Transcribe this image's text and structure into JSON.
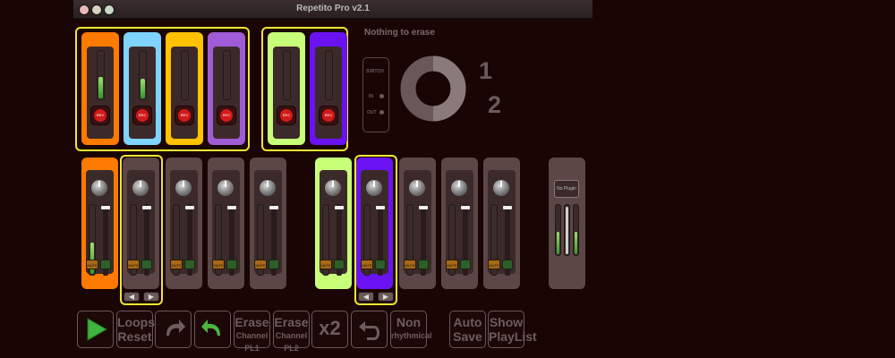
{
  "window": {
    "title": "Repetito Pro v2.1"
  },
  "status_text": "Nothing to erase",
  "loop_modes": [
    "SWITCH",
    "IN",
    "OUT"
  ],
  "loop_counter": {
    "first": "1",
    "second": "2"
  },
  "rec_label": "REC",
  "mute_label": "MUTE",
  "plugin_label": "No Plugin",
  "toolbar": {
    "loops_reset": [
      "Loops",
      "Reset"
    ],
    "erase_channel_pl1": [
      "Erase",
      "Channel PL1"
    ],
    "erase_channel_pl2": [
      "Erase",
      "Channel PL2"
    ],
    "x2": "x2",
    "non_rhythmical": [
      "Non",
      "rhythmical"
    ],
    "auto_save": [
      "Auto",
      "Save"
    ],
    "show_playlist": [
      "Show",
      "PlayList"
    ]
  },
  "colors": {
    "orange": "#ff7a00",
    "cyan": "#7fd3ff",
    "yellow": "#ffc200",
    "purple": "#a05bd6",
    "lime": "#c8ff78",
    "violet": "#6a12f2",
    "inactive": "#5c4646",
    "highlight": "#f2e531"
  },
  "looper_strips": [
    {
      "color": "orange",
      "level": 0.45
    },
    {
      "color": "cyan",
      "level": 0.4
    },
    {
      "color": "yellow",
      "level": 0
    },
    {
      "color": "purple",
      "level": 0
    },
    {
      "color": "lime",
      "level": 0
    },
    {
      "color": "violet",
      "level": 0
    }
  ],
  "mixer_channels": [
    {
      "color": "orange",
      "level": 0.45,
      "fader": 0.95
    },
    {
      "color": "inactive",
      "level": 0,
      "fader": 0.95
    },
    {
      "color": "inactive",
      "level": 0,
      "fader": 0.95
    },
    {
      "color": "inactive",
      "level": 0,
      "fader": 0.95
    },
    {
      "color": "inactive",
      "level": 0,
      "fader": 0.95
    },
    {
      "color": "lime",
      "level": 0,
      "fader": 0.95
    },
    {
      "color": "violet",
      "level": 0,
      "fader": 0.95
    },
    {
      "color": "inactive",
      "level": 0,
      "fader": 0.95
    },
    {
      "color": "inactive",
      "level": 0,
      "fader": 0.95
    },
    {
      "color": "inactive",
      "level": 0,
      "fader": 0.95
    }
  ],
  "master_levels": [
    0.45,
    0.95,
    0.45
  ],
  "loop_progress": 0.5
}
